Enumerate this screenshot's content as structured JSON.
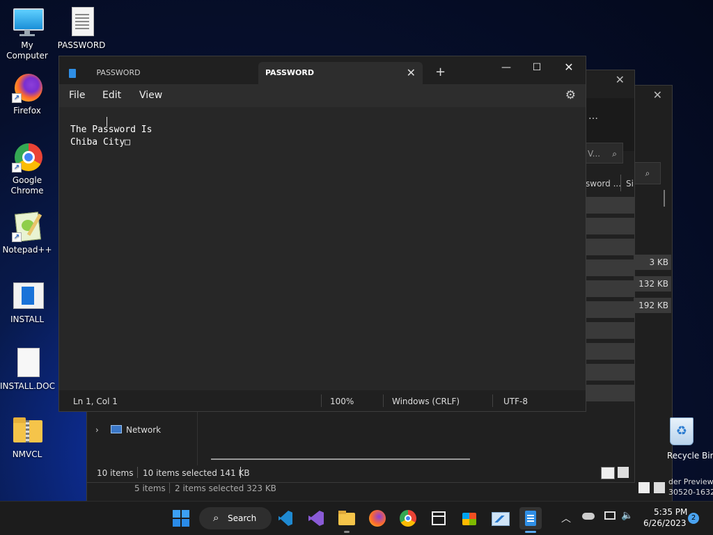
{
  "desktop": {
    "icons": [
      {
        "label": "My Computer"
      },
      {
        "label": "PASSWORD"
      },
      {
        "label": "Firefox"
      },
      {
        "label": "Google Chrome"
      },
      {
        "label": "Notepad++"
      },
      {
        "label": "INSTALL"
      },
      {
        "label": "INSTALL.DOC"
      },
      {
        "label": "NMVCL"
      },
      {
        "label": "Recycle Bin"
      }
    ],
    "build_text_line1": "der Preview",
    "build_text_line2": "30520-1632"
  },
  "explorer_back": {
    "search_partial": "V...",
    "col_header_name": "sword ...",
    "col_header_size": "Si",
    "sizes": [
      "3 KB",
      "132 KB",
      "192 KB"
    ],
    "nav_network": "Network",
    "status_items": "10 items",
    "status_selected": "10 items selected  141 KB",
    "status2_items": "5 items",
    "status2_selected": "2 items selected  323 KB"
  },
  "notepad": {
    "tab1_title": "PASSWORD",
    "tab2_title": "PASSWORD",
    "menu": {
      "file": "File",
      "edit": "Edit",
      "view": "View"
    },
    "content_line1": "The Password Is",
    "content_line2": "Chiba City□",
    "status": {
      "position": "Ln 1, Col 1",
      "zoom": "100%",
      "line_ending": "Windows (CRLF)",
      "encoding": "UTF-8"
    }
  },
  "taskbar": {
    "search_label": "Search",
    "time": "5:35 PM",
    "date": "6/26/2023",
    "notification_count": "2"
  }
}
